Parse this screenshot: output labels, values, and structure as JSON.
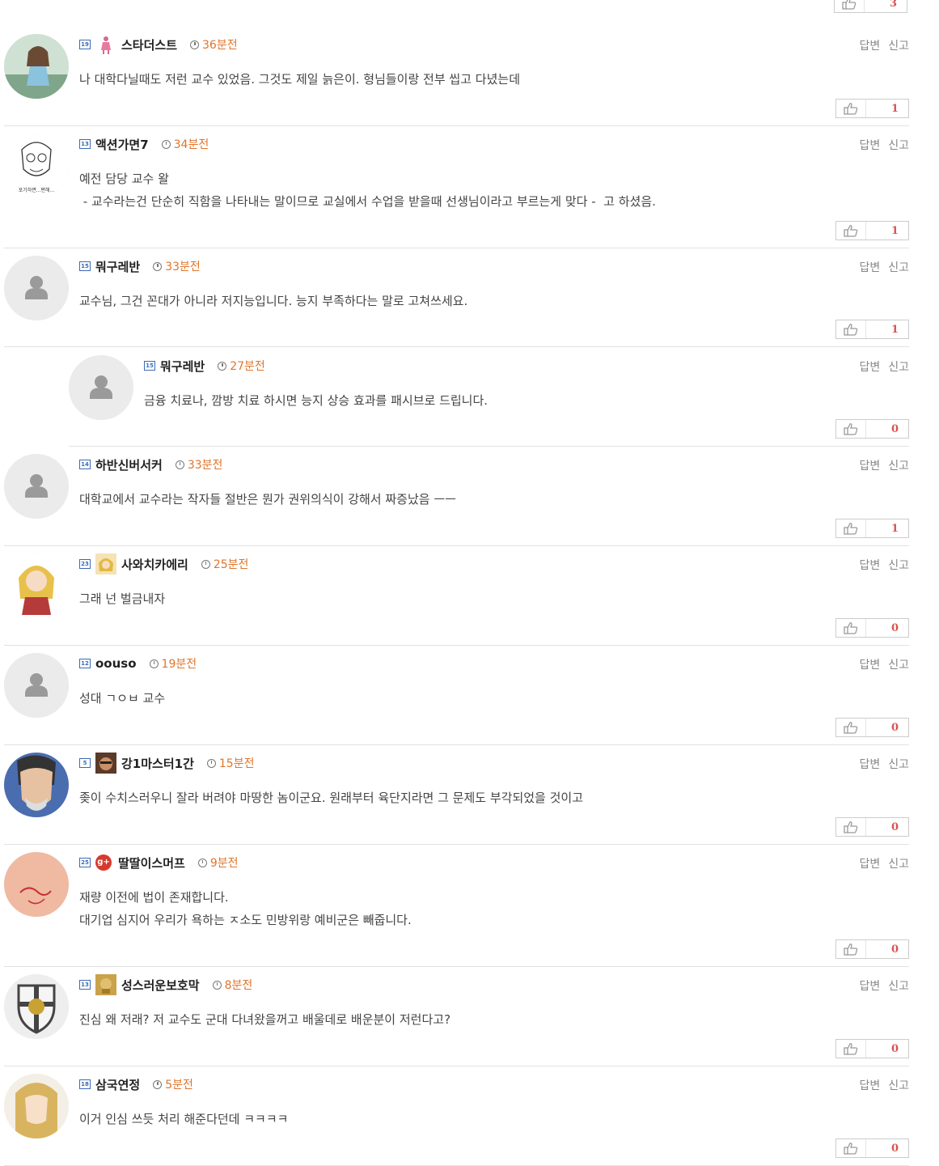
{
  "top_like_count": "3",
  "actions": {
    "reply": "답변",
    "report": "신고"
  },
  "comments": [
    {
      "level": "19",
      "nick": "스타더스트",
      "time": "36분전",
      "lines": [
        "나 대학다닐때도 저런 교수 있었음. 그것도 제일 늙은이. 형님들이랑 전부 씹고 다녔는데"
      ],
      "likes": "1",
      "avatar": "photo-girl",
      "mini": "pink-figure"
    },
    {
      "level": "13",
      "nick": "액션가면7",
      "time": "34분전",
      "lines": [
        "예전 담당 교수 왈",
        " - 교수라는건 단순히 직함을 나타내는 말이므로 교실에서 수업을 받을때 선생님이라고 부르는게 맞다 -  고 하셨음."
      ],
      "likes": "1",
      "avatar": "sketch-man"
    },
    {
      "level": "15",
      "nick": "뭐구레반",
      "time": "33분전",
      "lines": [
        "교수님, 그건 꼰대가 아니라 저지능입니다. 능지 부족하다는 말로 고쳐쓰세요."
      ],
      "likes": "1",
      "avatar": "default"
    },
    {
      "level": "15",
      "nick": "뭐구레반",
      "time": "27분전",
      "lines": [
        "금융 치료나, 깜방 치료 하시면 능지 상승 효과를 패시브로 드립니다."
      ],
      "likes": "0",
      "avatar": "default",
      "reply": true
    },
    {
      "level": "14",
      "nick": "하반신버서커",
      "time": "33분전",
      "lines": [
        "대학교에서 교수라는 작자들 절반은 뭔가 권위의식이 강해서 짜증났음 ㅡㅡ"
      ],
      "likes": "1",
      "avatar": "default"
    },
    {
      "level": "23",
      "nick": "사와치카에리",
      "time": "25분전",
      "lines": [
        "그래 넌 벌금내자"
      ],
      "likes": "0",
      "avatar": "anime-girl",
      "mini": "anime-mini"
    },
    {
      "level": "12",
      "nick": "oouso",
      "time": "19분전",
      "lines": [
        "성대 ㄱㅇㅂ 교수"
      ],
      "likes": "0",
      "avatar": "default"
    },
    {
      "level": "5",
      "nick": "강1마스터1간",
      "time": "15분전",
      "lines": [
        "좆이 수치스러우니 잘라 버려야 마땅한 놈이군요. 원래부터 육단지라면 그 문제도 부각되었을 것이고"
      ],
      "likes": "0",
      "avatar": "comic-man",
      "mini": "face-mini"
    },
    {
      "level": "25",
      "nick": "딸딸이스머프",
      "time": "9분전",
      "lines": [
        "재량 이전에 법이 존재합니다.",
        "대기업 심지어 우리가 욕하는 ㅈ소도 민방위랑 예비군은 빼줍니다."
      ],
      "likes": "0",
      "avatar": "skin",
      "gplus": "g+"
    },
    {
      "level": "13",
      "nick": "성스러운보호막",
      "time": "8분전",
      "lines": [
        "진심 왜 저래? 저 교수도 군대 다녀왔을꺼고 배울데로 배운분이 저런다고?"
      ],
      "likes": "0",
      "avatar": "shield",
      "mini": "gold-mini"
    },
    {
      "level": "18",
      "nick": "삼국연정",
      "time": "5분전",
      "lines": [
        "이거 인심 쓰듯 처리 해준다던데 ㅋㅋㅋㅋ"
      ],
      "likes": "0",
      "avatar": "blonde"
    }
  ]
}
